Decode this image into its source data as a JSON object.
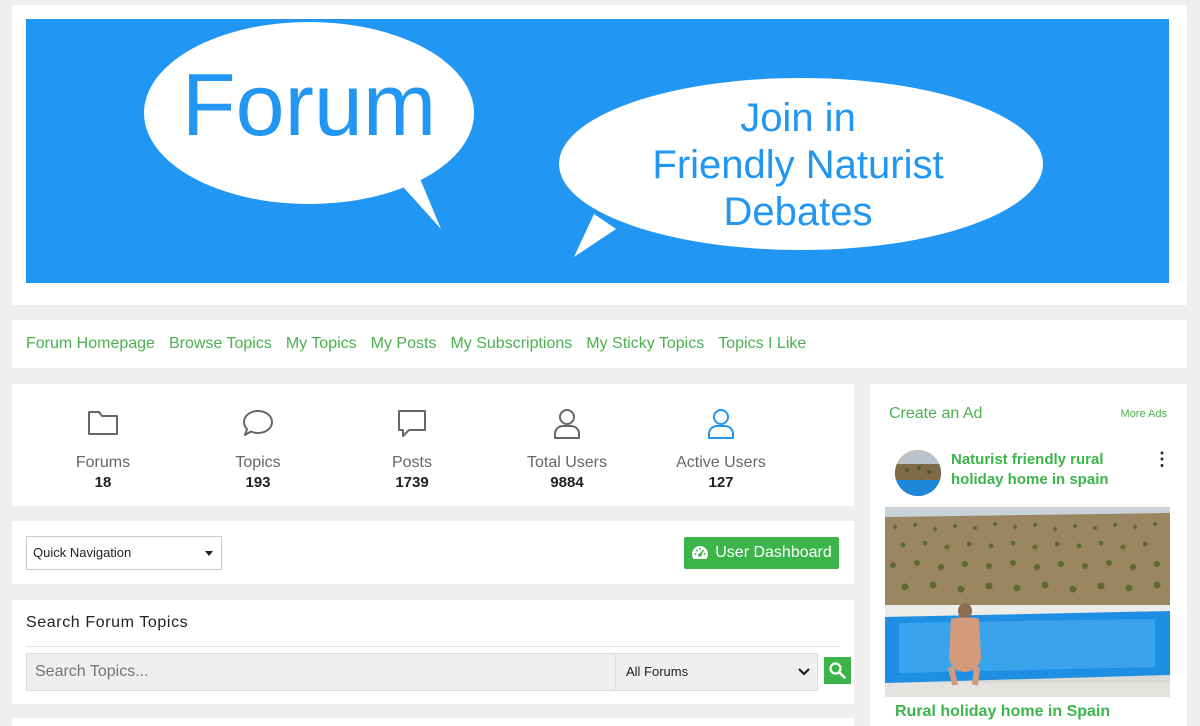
{
  "banner": {
    "bubble_left": "Forum",
    "bubble_right_lines": [
      "Join in",
      "Friendly Naturist",
      "Debates"
    ]
  },
  "nav": {
    "items": [
      {
        "label": "Forum Homepage"
      },
      {
        "label": "Browse Topics"
      },
      {
        "label": "My Topics"
      },
      {
        "label": "My Posts"
      },
      {
        "label": "My Subscriptions"
      },
      {
        "label": "My Sticky Topics"
      },
      {
        "label": "Topics I Like"
      }
    ]
  },
  "stats": [
    {
      "label": "Forums",
      "value": "18",
      "icon": "folder-icon"
    },
    {
      "label": "Topics",
      "value": "193",
      "icon": "chat-bubble-icon"
    },
    {
      "label": "Posts",
      "value": "1739",
      "icon": "message-square-icon"
    },
    {
      "label": "Total Users",
      "value": "9884",
      "icon": "user-icon"
    },
    {
      "label": "Active Users",
      "value": "127",
      "icon": "user-active-icon"
    }
  ],
  "quick_nav": {
    "selected": "Quick Navigation",
    "dashboard_label": "User Dashboard"
  },
  "search": {
    "title": "Search Forum Topics",
    "placeholder": "Search Topics...",
    "forum_selected": "All Forums"
  },
  "ad": {
    "create_label": "Create an Ad",
    "more_label": "More Ads",
    "title": "Naturist friendly rural holiday home in spain",
    "caption": "Rural holiday home in Spain"
  },
  "colors": {
    "brand_green": "#3bb54a",
    "link_green": "#4caf50",
    "banner_blue": "#2196f3",
    "active_user_blue": "#2196f3"
  }
}
